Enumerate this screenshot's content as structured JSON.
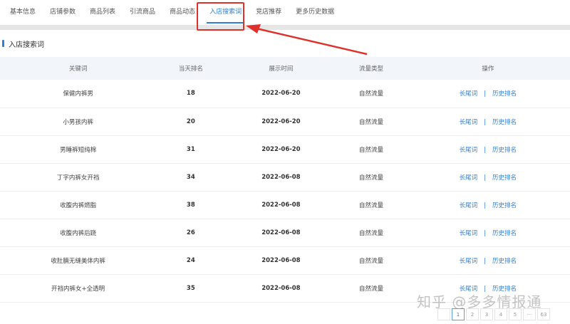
{
  "tabs": [
    "基本信息",
    "店铺参数",
    "商品列表",
    "引流商品",
    "商品动态",
    "入店搜索词",
    "竞店推荐",
    "更多历史数据"
  ],
  "active_tab": 5,
  "section_title": "入店搜索词",
  "columns": [
    "关键词",
    "当天排名",
    "展示时间",
    "流量类型",
    "操作"
  ],
  "rows": [
    {
      "keyword": "保健内裤男",
      "rank": "18",
      "date": "2022-06-20",
      "type": "自然流量"
    },
    {
      "keyword": "小男孩内裤",
      "rank": "20",
      "date": "2022-06-20",
      "type": "自然流量"
    },
    {
      "keyword": "男睡裤短纯棉",
      "rank": "31",
      "date": "2022-06-20",
      "type": "自然流量"
    },
    {
      "keyword": "丁字内裤女开裆",
      "rank": "34",
      "date": "2022-06-08",
      "type": "自然流量"
    },
    {
      "keyword": "收腹内裤燃脂",
      "rank": "38",
      "date": "2022-06-08",
      "type": "自然流量"
    },
    {
      "keyword": "收腹内裤后跷",
      "rank": "26",
      "date": "2022-06-08",
      "type": "自然流量"
    },
    {
      "keyword": "收肚腩无缝美体内裤",
      "rank": "24",
      "date": "2022-06-08",
      "type": "自然流量"
    },
    {
      "keyword": "开裆内裤女+全透明",
      "rank": "35",
      "date": "2022-06-08",
      "type": "自然流量"
    }
  ],
  "actions": {
    "long_tail": "长尾词",
    "history": "历史排名",
    "sep": "|"
  },
  "pagination": [
    "1",
    "2",
    "3",
    "4",
    "5",
    "···",
    "63"
  ],
  "watermark": "知乎 @多多情报通",
  "colors": {
    "accent": "#2f7fd8",
    "highlight": "#e0302c"
  }
}
